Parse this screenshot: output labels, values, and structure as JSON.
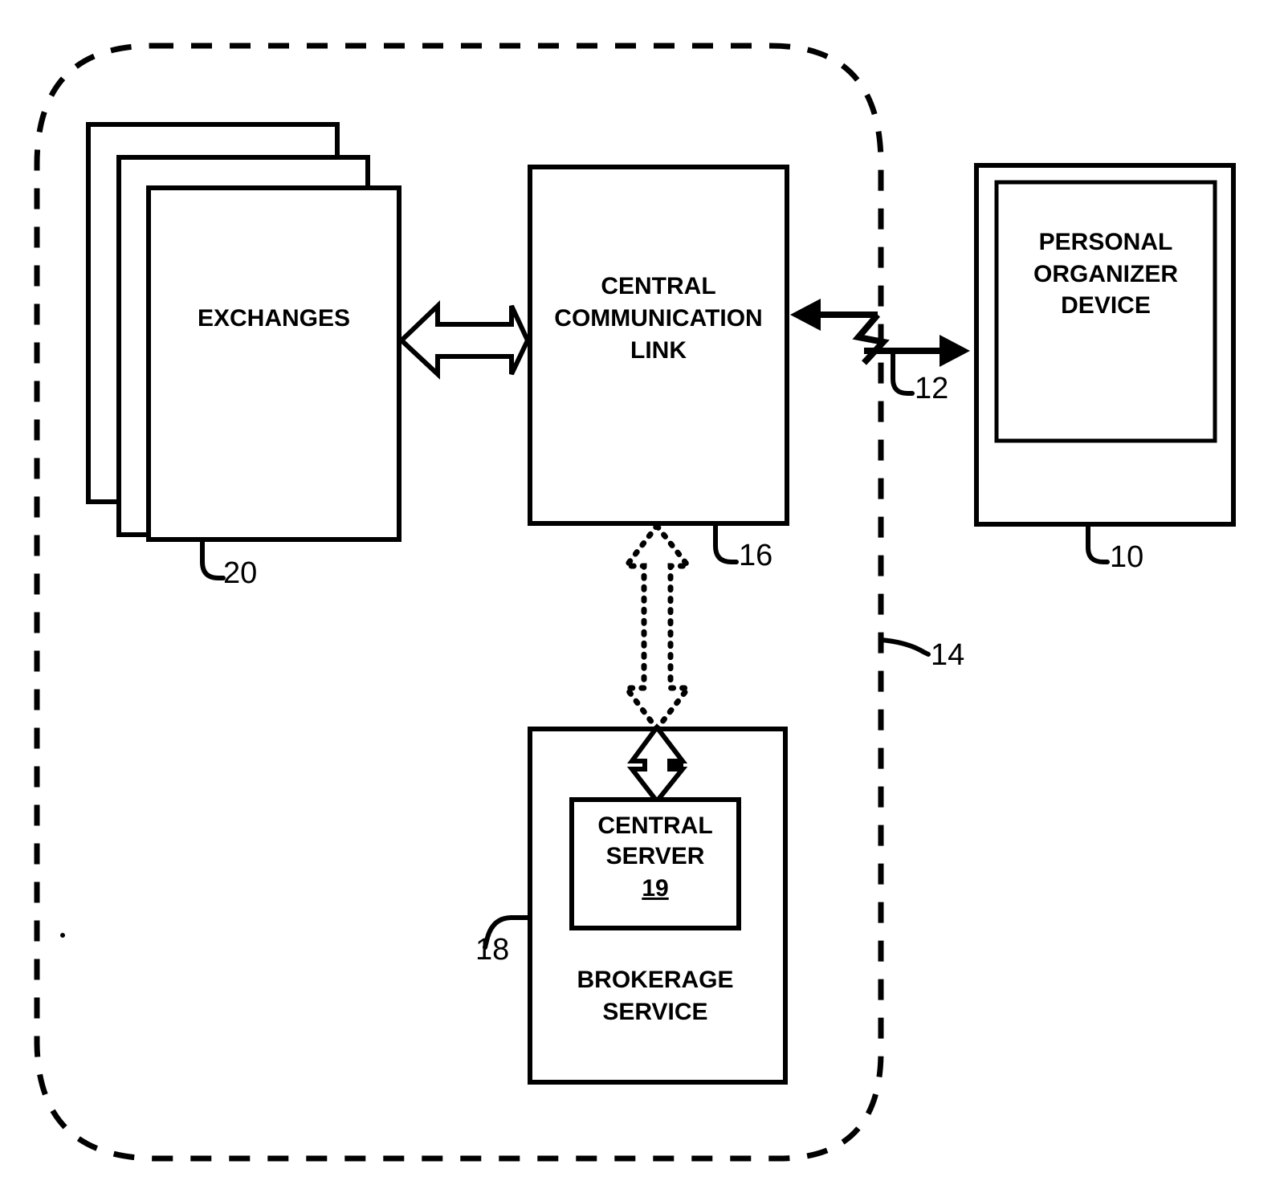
{
  "figure": {
    "title": "Trading system block diagram",
    "background_color": "#ffffff",
    "line_color": "#000000"
  },
  "boundary": {
    "name": "system-boundary",
    "style": "dashed-rounded-rectangle",
    "reference_number": "14"
  },
  "nodes": [
    {
      "id": "exchanges",
      "label": "EXCHANGES",
      "reference_number": "20",
      "style": "stacked-pages",
      "stack_count": 3
    },
    {
      "id": "central-communication-link",
      "label": "CENTRAL\nCOMMUNICATION\nLINK",
      "label_lines": [
        "CENTRAL",
        "COMMUNICATION",
        "LINK"
      ],
      "reference_number": "16",
      "style": "rectangle"
    },
    {
      "id": "personal-organizer-device",
      "label_lines": [
        "PERSONAL",
        "ORGANIZER",
        "DEVICE"
      ],
      "reference_number": "10",
      "style": "device-with-screen"
    },
    {
      "id": "brokerage-service",
      "label_lines": [
        "BROKERAGE",
        "SERVICE"
      ],
      "reference_number": "18",
      "style": "rectangle"
    },
    {
      "id": "central-server",
      "label_lines": [
        "CENTRAL",
        "SERVER"
      ],
      "reference_number": "19",
      "style": "inner-rectangle"
    }
  ],
  "connectors": [
    {
      "id": "exchanges-to-link",
      "from": "exchanges",
      "to": "central-communication-link",
      "style": "hollow-double-block-arrow",
      "direction": "bidirectional"
    },
    {
      "id": "wireless-link",
      "from": "central-communication-link",
      "to": "personal-organizer-device",
      "style": "zigzag-wireless-arrows",
      "direction": "bidirectional",
      "reference_number": "12"
    },
    {
      "id": "link-to-brokerage",
      "from": "central-communication-link",
      "to": "brokerage-service",
      "style": "dotted-double-block-arrow",
      "direction": "bidirectional"
    },
    {
      "id": "brokerage-to-server",
      "from": "brokerage-service",
      "to": "central-server",
      "style": "hollow-double-block-arrow",
      "direction": "bidirectional"
    }
  ],
  "labels": {
    "exchanges": "EXCHANGES",
    "central_line1": "CENTRAL",
    "central_line2": "COMMUNICATION",
    "central_line3": "LINK",
    "organizer_line1": "PERSONAL",
    "organizer_line2": "ORGANIZER",
    "organizer_line3": "DEVICE",
    "server_line1": "CENTRAL",
    "server_line2": "SERVER",
    "server_num": "19",
    "brokerage_line1": "BROKERAGE",
    "brokerage_line2": "SERVICE"
  },
  "reference_numbers": {
    "device": "10",
    "wireless": "12",
    "boundary": "14",
    "comm_link": "16",
    "brokerage": "18",
    "server": "19",
    "exchanges": "20"
  }
}
